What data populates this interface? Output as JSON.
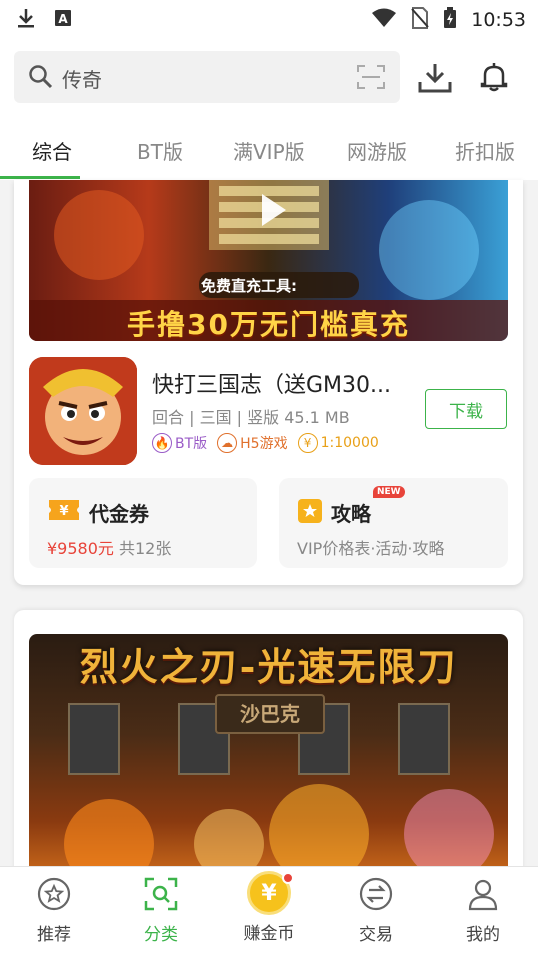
{
  "status_bar": {
    "time": "10:53"
  },
  "search": {
    "placeholder": "传奇"
  },
  "tabs": [
    {
      "label": "综合",
      "active": true
    },
    {
      "label": "BT版"
    },
    {
      "label": "满VIP版"
    },
    {
      "label": "网游版"
    },
    {
      "label": "折扣版"
    }
  ],
  "banner1": {
    "caption": "手撸30万无门槛真充",
    "caption2": "免费直充工具:"
  },
  "game": {
    "title": "快打三国志（送GM30...",
    "meta": "回合 | 三国 | 竖版 45.1 MB",
    "tags": [
      {
        "label": "BT版",
        "icon": "flame-icon"
      },
      {
        "label": "H5游戏",
        "icon": "cloud-icon"
      },
      {
        "label": "1:10000",
        "icon": "coin-icon"
      }
    ],
    "download_label": "下载"
  },
  "voucher": {
    "title": "代金券",
    "amount": "¥9580元",
    "count": "共12张"
  },
  "guide": {
    "title": "攻略",
    "badge": "NEW",
    "subtitle": "VIP价格表·活动·攻略"
  },
  "banner2": {
    "title": "烈火之刃-光速无限刀",
    "subtitle": "沙巴克"
  },
  "bottom_nav": [
    {
      "label": "推荐",
      "icon": "star-icon"
    },
    {
      "label": "分类",
      "icon": "category-icon",
      "active": true
    },
    {
      "label": "赚金币",
      "icon": "gold-coin-icon"
    },
    {
      "label": "交易",
      "icon": "exchange-icon"
    },
    {
      "label": "我的",
      "icon": "profile-icon"
    }
  ],
  "colors": {
    "accent": "#3cb34a",
    "price": "#e8443a"
  }
}
